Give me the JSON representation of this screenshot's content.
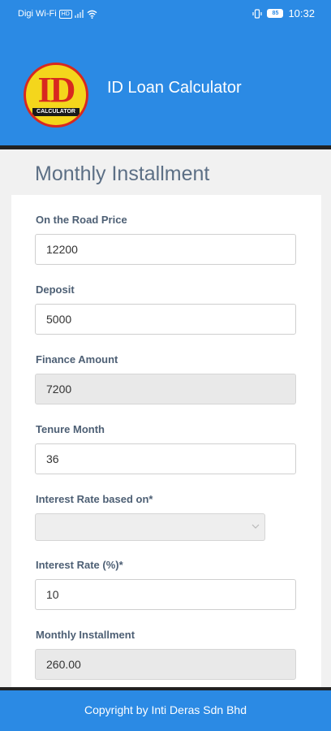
{
  "status_bar": {
    "carrier": "Digi Wi-Fi",
    "wifi_badge": "HD",
    "battery": "85",
    "time": "10:32"
  },
  "app_bar": {
    "logo_text": "ID",
    "logo_subtext": "CALCULATOR",
    "title": "ID Loan Calculator"
  },
  "page": {
    "title": "Monthly Installment"
  },
  "form": {
    "road_price_label": "On the Road Price",
    "road_price_value": "12200",
    "deposit_label": "Deposit",
    "deposit_value": "5000",
    "finance_label": "Finance Amount",
    "finance_value": "7200",
    "tenure_label": "Tenure Month",
    "tenure_value": "36",
    "interest_basis_label": "Interest Rate based on*",
    "interest_basis_value": "",
    "interest_rate_label": "Interest Rate (%)*",
    "interest_rate_value": "10",
    "monthly_label": "Monthly Installment",
    "monthly_value": "260.00"
  },
  "footer": {
    "copyright": "Copyright by Inti Deras Sdn Bhd"
  },
  "colors": {
    "primary": "#2b8ae4",
    "label": "#4d5f74",
    "logo_yellow": "#f4d61c",
    "logo_red": "#d8281f"
  }
}
